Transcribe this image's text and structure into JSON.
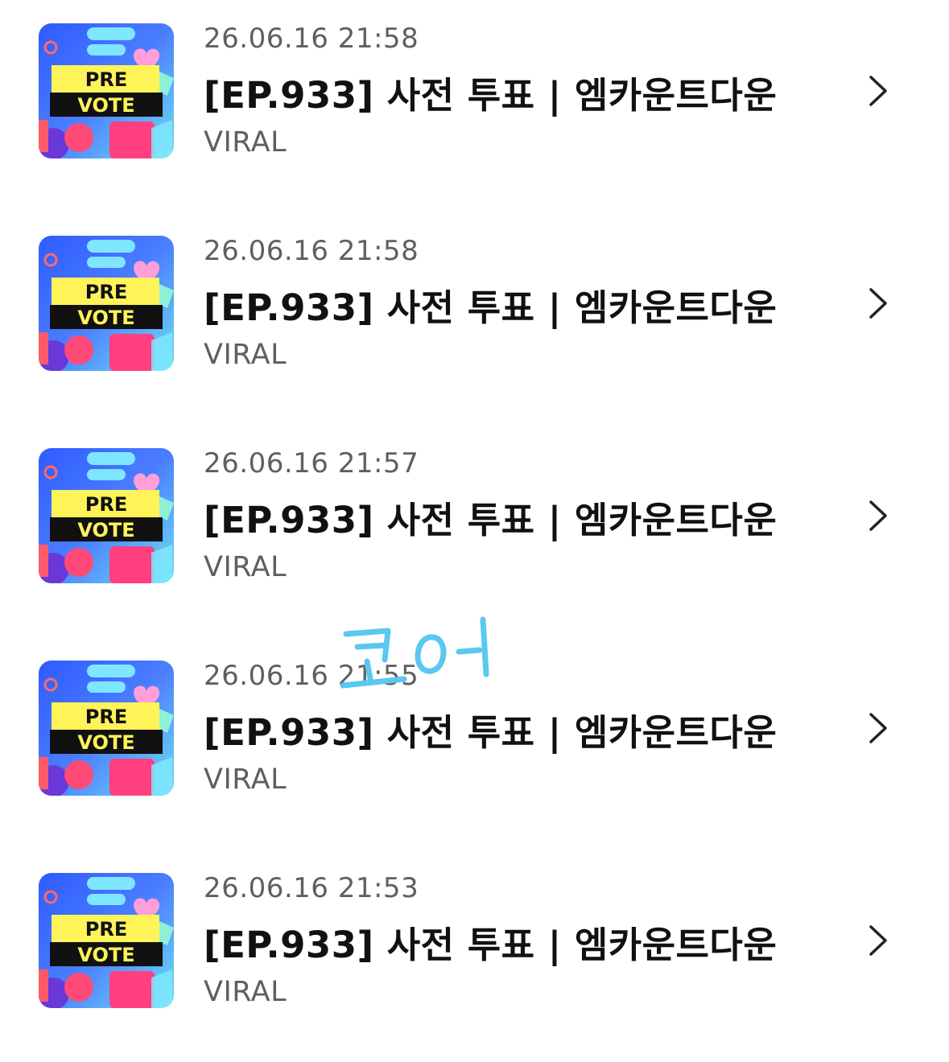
{
  "colors": {
    "title": "#111111",
    "secondary": "#5f5f5f",
    "chevron": "#222222",
    "annotation": "#5ac8f0",
    "thumb_bg": "#3d6bff",
    "thumb_banner": "#fff35a"
  },
  "items": [
    {
      "thumb_line1": "PRE",
      "thumb_line2": "VOTE",
      "date": "26.06.16 21:58",
      "title": "[EP.933] 사전 투표 | 엠카운트다운",
      "category": "VIRAL",
      "chevron_icon": "chevron-right-icon"
    },
    {
      "thumb_line1": "PRE",
      "thumb_line2": "VOTE",
      "date": "26.06.16 21:58",
      "title": "[EP.933] 사전 투표 | 엠카운트다운",
      "category": "VIRAL",
      "chevron_icon": "chevron-right-icon"
    },
    {
      "thumb_line1": "PRE",
      "thumb_line2": "VOTE",
      "date": "26.06.16 21:57",
      "title": "[EP.933] 사전 투표 | 엠카운트다운",
      "category": "VIRAL",
      "chevron_icon": "chevron-right-icon"
    },
    {
      "thumb_line1": "PRE",
      "thumb_line2": "VOTE",
      "date": "26.06.16 21:55",
      "title": "[EP.933] 사전 투표 | 엠카운트다운",
      "category": "VIRAL",
      "chevron_icon": "chevron-right-icon"
    },
    {
      "thumb_line1": "PRE",
      "thumb_line2": "VOTE",
      "date": "26.06.16 21:53",
      "title": "[EP.933] 사전 투표 | 엠카운트다운",
      "category": "VIRAL",
      "chevron_icon": "chevron-right-icon"
    }
  ],
  "annotation": {
    "text": "코어"
  }
}
